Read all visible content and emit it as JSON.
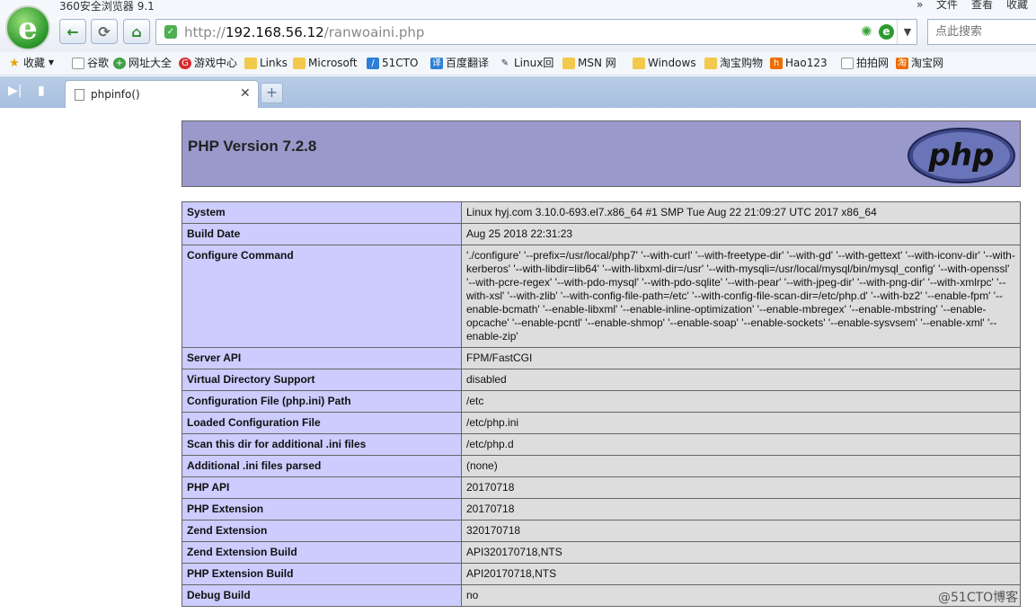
{
  "app": {
    "title": "360安全浏览器 9.1",
    "title_menu": [
      "»",
      "文件",
      "查看",
      "收藏"
    ]
  },
  "nav": {
    "back_icon": "arrow-left-icon",
    "refresh_icon": "refresh-icon",
    "home_icon": "home-icon",
    "url_prefix": "http://",
    "url_host": "192.168.56.12",
    "url_path": "/ranwoaini.php",
    "search_placeholder": "点此搜索"
  },
  "bookmarks": [
    {
      "label": "收藏",
      "icon": "star-icon"
    },
    {
      "label": "谷歌",
      "icon": "page-icon"
    },
    {
      "label": "网址大全",
      "icon": "globe-icon"
    },
    {
      "label": "游戏中心",
      "icon": "game-icon"
    },
    {
      "label": "Links",
      "icon": "folder-icon"
    },
    {
      "label": "Microsoft",
      "icon": "folder-icon"
    },
    {
      "label": "51CTO",
      "icon": "pen-icon"
    },
    {
      "label": "百度翻译",
      "icon": "translate-icon"
    },
    {
      "label": "Linux回",
      "icon": "linux-icon"
    },
    {
      "label": "MSN 网",
      "icon": "folder-icon"
    },
    {
      "label": "Windows",
      "icon": "folder-icon"
    },
    {
      "label": "淘宝购物",
      "icon": "folder-icon"
    },
    {
      "label": "Hao123",
      "icon": "hao123-icon"
    },
    {
      "label": "拍拍网",
      "icon": "page-icon"
    },
    {
      "label": "淘宝网",
      "icon": "taobao-icon"
    }
  ],
  "tabs": [
    {
      "label": "phpinfo()",
      "active": true
    }
  ],
  "page": {
    "version": "PHP Version 7.2.8",
    "logo_text": "php",
    "rows": [
      {
        "key": "System",
        "value": "Linux hyj.com 3.10.0-693.el7.x86_64 #1 SMP Tue Aug 22 21:09:27 UTC 2017 x86_64"
      },
      {
        "key": "Build Date",
        "value": "Aug 25 2018 22:31:23"
      },
      {
        "key": "Configure Command",
        "value": "'./configure' '--prefix=/usr/local/php7' '--with-curl' '--with-freetype-dir' '--with-gd' '--with-gettext' '--with-iconv-dir' '--with-kerberos' '--with-libdir=lib64' '--with-libxml-dir=/usr' '--with-mysqli=/usr/local/mysql/bin/mysql_config' '--with-openssl' '--with-pcre-regex' '--with-pdo-mysql' '--with-pdo-sqlite' '--with-pear' '--with-jpeg-dir' '--with-png-dir' '--with-xmlrpc' '--with-xsl' '--with-zlib' '--with-config-file-path=/etc' '--with-config-file-scan-dir=/etc/php.d' '--with-bz2' '--enable-fpm' '--enable-bcmath' '--enable-libxml' '--enable-inline-optimization' '--enable-mbregex' '--enable-mbstring' '--enable-opcache' '--enable-pcntl' '--enable-shmop' '--enable-soap' '--enable-sockets' '--enable-sysvsem' '--enable-xml' '--enable-zip'"
      },
      {
        "key": "Server API",
        "value": "FPM/FastCGI"
      },
      {
        "key": "Virtual Directory Support",
        "value": "disabled"
      },
      {
        "key": "Configuration File (php.ini) Path",
        "value": "/etc"
      },
      {
        "key": "Loaded Configuration File",
        "value": "/etc/php.ini"
      },
      {
        "key": "Scan this dir for additional .ini files",
        "value": "/etc/php.d"
      },
      {
        "key": "Additional .ini files parsed",
        "value": "(none)"
      },
      {
        "key": "PHP API",
        "value": "20170718"
      },
      {
        "key": "PHP Extension",
        "value": "20170718"
      },
      {
        "key": "Zend Extension",
        "value": "320170718"
      },
      {
        "key": "Zend Extension Build",
        "value": "API320170718,NTS"
      },
      {
        "key": "PHP Extension Build",
        "value": "API20170718,NTS"
      },
      {
        "key": "Debug Build",
        "value": "no"
      }
    ]
  },
  "watermark": "@51CTO博客",
  "colors": {
    "php_header": "#9999cc",
    "key_cell": "#ccccff",
    "value_cell": "#dddddd"
  }
}
